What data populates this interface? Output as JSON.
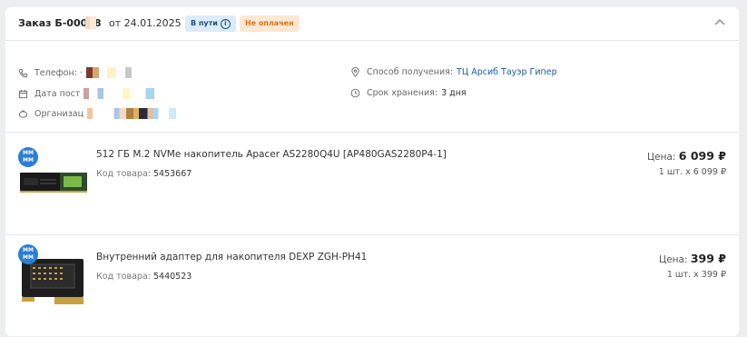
{
  "header": {
    "title": "Заказ Б-00048",
    "date": "от 24.01.2025",
    "status_badge": "В пути",
    "status_info_icon": "info-icon",
    "payment_badge": "Не оплачен",
    "collapse_icon": "chevron-up-icon"
  },
  "info": {
    "phone_label": "Телефон: ·",
    "date_label": "Дата пост",
    "org_label": "Организац",
    "delivery_label": "Способ получения:",
    "delivery_value": "ТЦ Арсиб Тауэр Гипер",
    "storage_label": "Срок хранения:",
    "storage_value": "3 дня"
  },
  "items": [
    {
      "name": "512 ГБ M.2 NVMe накопитель Apacer AS2280Q4U [AP480GAS2280P4-1]",
      "sku_label": "Код товара:",
      "sku": "5453667",
      "price_label": "Цена:",
      "price": "6 099 ₽",
      "qty": "1 шт. x 6 099 ₽",
      "badge_top": "ММ",
      "badge_bottom": "ММ"
    },
    {
      "name": "Внутренний адаптер для накопителя DEXP ZGH-PH41",
      "sku_label": "Код товара:",
      "sku": "5440523",
      "price_label": "Цена:",
      "price": "399 ₽",
      "qty": "1 шт. x 399 ₽",
      "badge_top": "ММ",
      "badge_bottom": "ММ"
    }
  ],
  "colors": {
    "link": "#1a5aa8",
    "transit_bg": "#dcebf8",
    "unpaid_bg": "#fde8d2",
    "unpaid_text": "#d9731f",
    "mm_badge": "#2a7fd4"
  }
}
